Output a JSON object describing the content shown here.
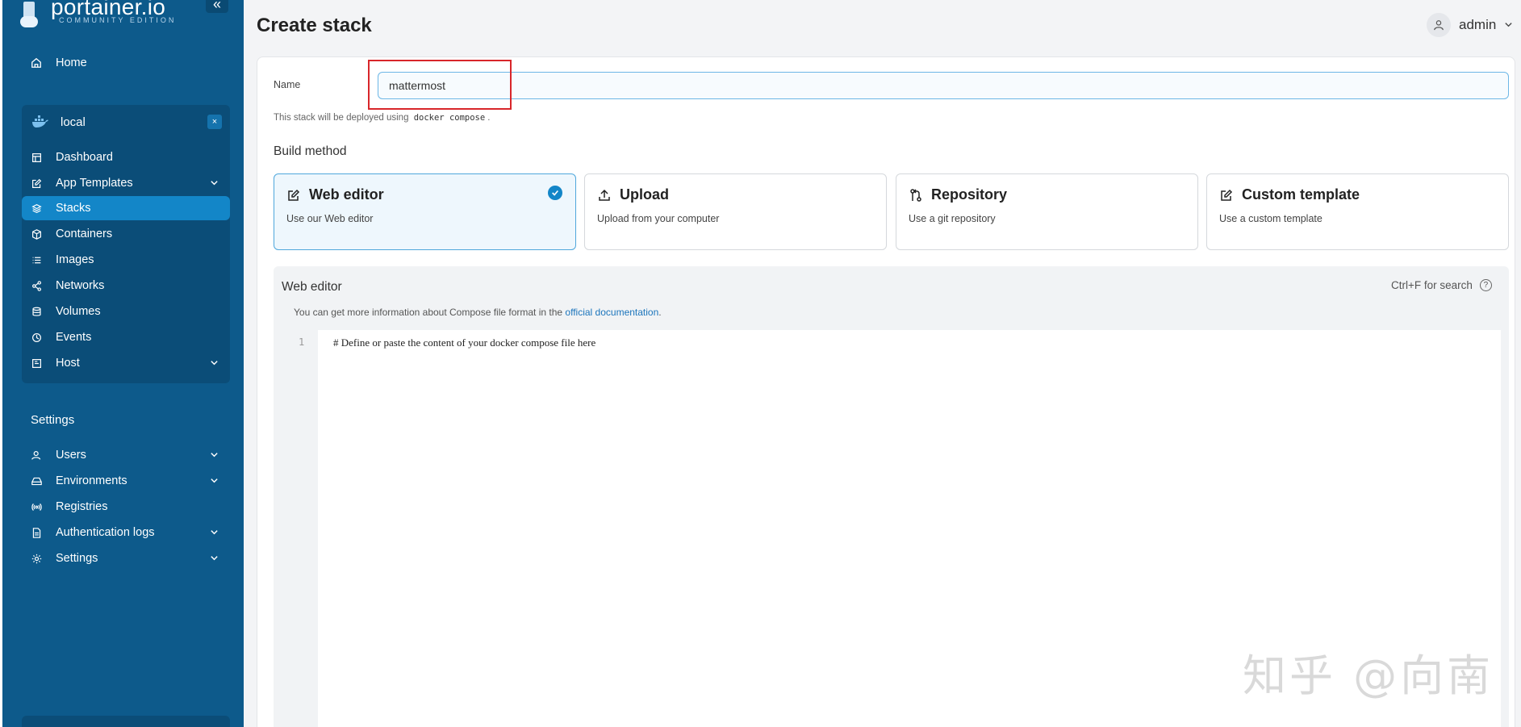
{
  "brand": {
    "name": "portainer.io",
    "edition": "COMMUNITY EDITION"
  },
  "sidebar": {
    "home": "Home",
    "environment": {
      "name": "local",
      "close": "×"
    },
    "env_items": [
      {
        "label": "Dashboard",
        "icon": "dashboard-icon"
      },
      {
        "label": "App Templates",
        "icon": "edit-icon",
        "expandable": true
      },
      {
        "label": "Stacks",
        "icon": "layers-icon",
        "active": true
      },
      {
        "label": "Containers",
        "icon": "box-icon"
      },
      {
        "label": "Images",
        "icon": "list-icon"
      },
      {
        "label": "Networks",
        "icon": "share-icon"
      },
      {
        "label": "Volumes",
        "icon": "database-icon"
      },
      {
        "label": "Events",
        "icon": "clock-icon"
      },
      {
        "label": "Host",
        "icon": "server-icon",
        "expandable": true
      }
    ],
    "settings_title": "Settings",
    "settings_items": [
      {
        "label": "Users",
        "icon": "user-icon",
        "expandable": true
      },
      {
        "label": "Environments",
        "icon": "hdd-icon",
        "expandable": true
      },
      {
        "label": "Registries",
        "icon": "radio-icon"
      },
      {
        "label": "Authentication logs",
        "icon": "file-icon",
        "expandable": true
      },
      {
        "label": "Settings",
        "icon": "gear-icon",
        "expandable": true
      }
    ]
  },
  "header": {
    "title": "Create stack",
    "user": "admin"
  },
  "form": {
    "name_label": "Name",
    "name_value": "mattermost",
    "deploy_note_prefix": "This stack will be deployed using",
    "deploy_note_code": "docker compose",
    "deploy_note_suffix": "."
  },
  "build": {
    "title": "Build method",
    "methods": [
      {
        "title": "Web editor",
        "desc": "Use our Web editor",
        "selected": true
      },
      {
        "title": "Upload",
        "desc": "Upload from your computer"
      },
      {
        "title": "Repository",
        "desc": "Use a git repository"
      },
      {
        "title": "Custom template",
        "desc": "Use a custom template"
      }
    ]
  },
  "editor": {
    "title": "Web editor",
    "hint": "Ctrl+F for search",
    "hint_icon": "?",
    "info_prefix": "You can get more information about Compose file format in the",
    "info_link": "official documentation",
    "info_suffix": ".",
    "line_number": "1",
    "code": "# Define or paste the content of your docker compose file here"
  },
  "watermark": "知乎 @向南",
  "colors": {
    "sidebar": "#0d5a8b",
    "active": "#1386c8",
    "highlight": "#d8262a"
  }
}
